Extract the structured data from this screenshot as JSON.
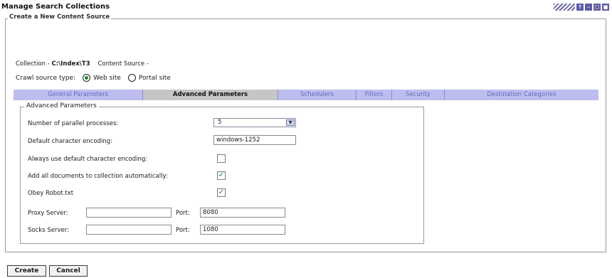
{
  "page_title": "Manage Search Collections",
  "header_icons": [
    "help-icon",
    "minimize-icon",
    "maximize-icon",
    "close-icon"
  ],
  "section_legend": "Create a New Content Source",
  "collection_label": "Collection -",
  "collection_value": "C:\\Index\\T3",
  "content_source_label": "Content Source -",
  "crawl_source_label": "Crawl source type:",
  "crawl_options": [
    {
      "label": "Web site",
      "selected": true
    },
    {
      "label": "Portal site",
      "selected": false
    }
  ],
  "tabs": [
    {
      "label": "General Parameters",
      "active": false
    },
    {
      "label": "Advanced Parameters",
      "active": true
    },
    {
      "label": "Schedulers",
      "active": false
    },
    {
      "label": "Filters",
      "active": false
    },
    {
      "label": "Security",
      "active": false
    },
    {
      "label": "Destination Categories",
      "active": false
    }
  ],
  "advanced_legend": "Advanced Parameters",
  "fields": {
    "parallel_processes_label": "Number of parallel processes:",
    "parallel_processes_value": "5",
    "default_encoding_label": "Default character encoding:",
    "default_encoding_value": "windows-1252",
    "always_default_label": "Always use default character encoding:",
    "always_default_checked": false,
    "add_all_docs_label": "Add all documents to collection automatically:",
    "add_all_docs_checked": true,
    "obey_robot_label": "Obey Robot.txt",
    "obey_robot_checked": true,
    "proxy_server_label": "Proxy Server:",
    "proxy_server_value": "",
    "proxy_port_label": "Port:",
    "proxy_port_value": "8080",
    "socks_server_label": "Socks Server:",
    "socks_server_value": "",
    "socks_port_label": "Port:",
    "socks_port_value": "1080"
  },
  "buttons": {
    "create": "Create",
    "cancel": "Cancel"
  },
  "colors": {
    "tab_bar": "#bdbdf0",
    "active_tab": "#c6c6c6",
    "check_green": "#0f8a1f"
  }
}
